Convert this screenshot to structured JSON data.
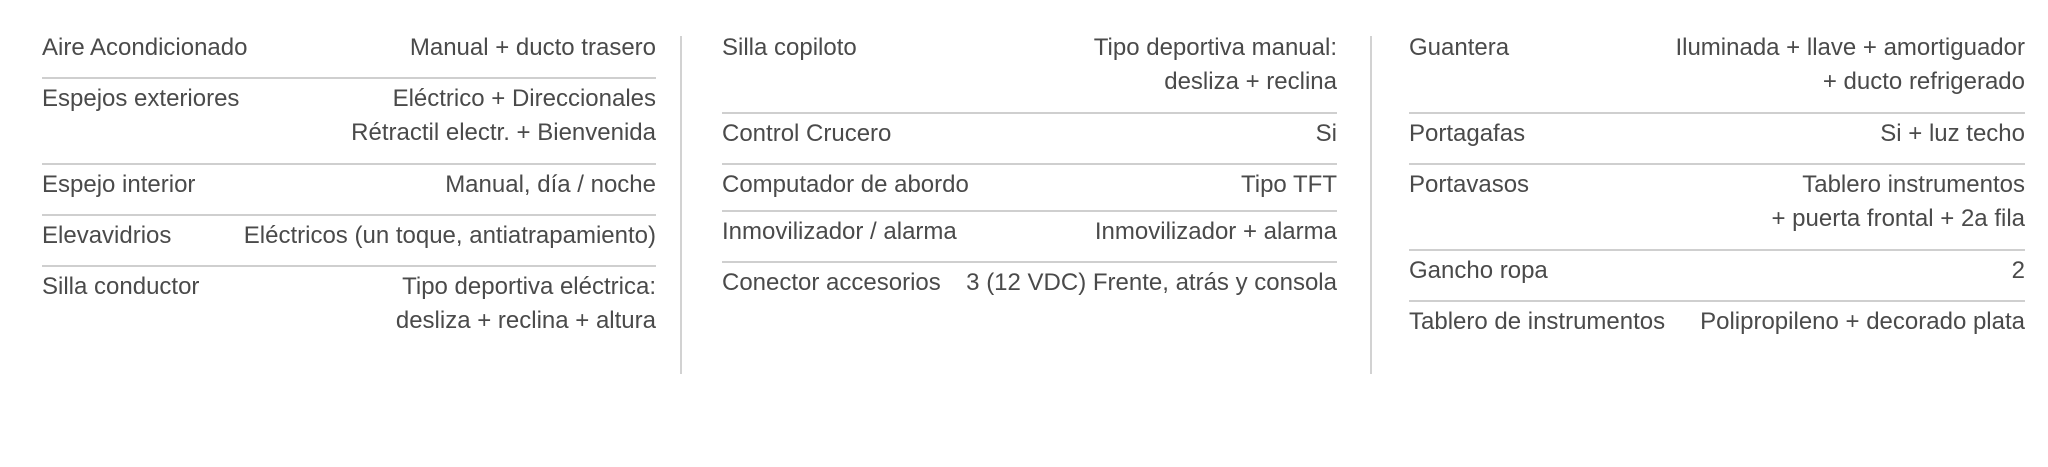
{
  "columns": [
    {
      "rows": [
        {
          "label": "Aire Acondicionado",
          "value": "Manual + ducto trasero"
        },
        {
          "label": "Espejos exteriores",
          "value": "Eléctrico + Direccionales\nRétractil  electr. + Bienvenida"
        },
        {
          "label": "Espejo interior",
          "value": "Manual, día / noche"
        },
        {
          "label": "Elevavidrios",
          "value": "Eléctricos (un toque, antiatrapamiento)"
        },
        {
          "label": "Silla conductor",
          "value": "Tipo deportiva eléctrica:\ndesliza + reclina + altura"
        }
      ]
    },
    {
      "rows": [
        {
          "label": "Silla copiloto",
          "value": "Tipo deportiva manual:\ndesliza + reclina"
        },
        {
          "label": "Control Crucero",
          "value": "Si"
        },
        {
          "label": "Computador de abordo",
          "value": "Tipo TFT"
        },
        {
          "label": "Inmovilizador / alarma",
          "value": "Inmovilizador + alarma"
        },
        {
          "label": "Conector accesorios",
          "value": "3 (12 VDC) Frente, atrás y consola"
        }
      ]
    },
    {
      "rows": [
        {
          "label": "Guantera",
          "value": "Iluminada + llave + amortiguador\n+ ducto refrigerado"
        },
        {
          "label": "Portagafas",
          "value": "Si + luz techo"
        },
        {
          "label": "Portavasos",
          "value": "Tablero instrumentos\n+ puerta frontal + 2a fila"
        },
        {
          "label": "Gancho ropa",
          "value": "2"
        },
        {
          "label": "Tablero de instrumentos",
          "value": "Polipropileno + decorado plata"
        }
      ]
    }
  ]
}
